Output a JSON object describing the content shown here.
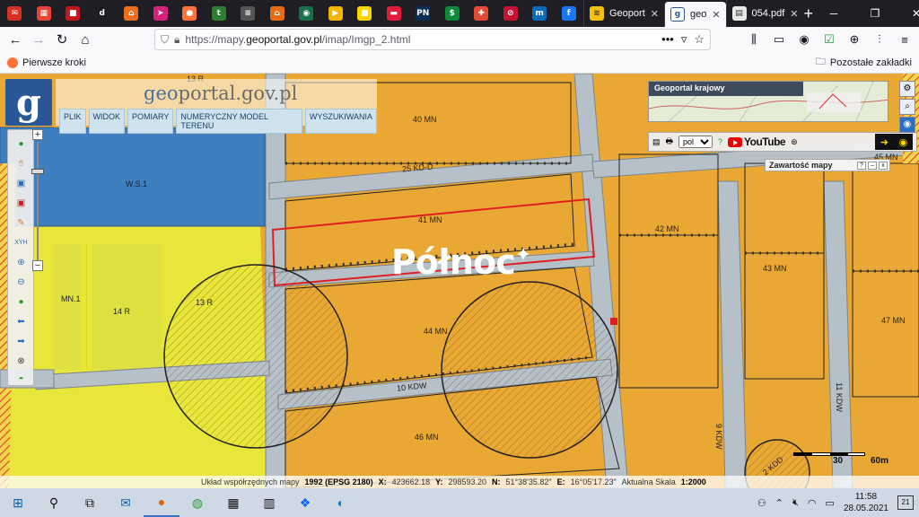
{
  "browser": {
    "pinned_tabs": [
      {
        "icon": "mail-icon",
        "bg": "#d93025",
        "glyph": "✉"
      },
      {
        "icon": "grid-icon",
        "bg": "#ea4335",
        "glyph": "▦"
      },
      {
        "icon": "news-icon",
        "bg": "#c4161c",
        "glyph": "■"
      },
      {
        "icon": "d-icon",
        "bg": "#1f1e25",
        "glyph": "d"
      },
      {
        "icon": "home-icon",
        "bg": "#f06c1e",
        "glyph": "⌂"
      },
      {
        "icon": "arrow-icon",
        "bg": "#d4227b",
        "glyph": "➤"
      },
      {
        "icon": "firefox-icon",
        "bg": "#ff7139",
        "glyph": "●"
      },
      {
        "icon": "t-icon",
        "bg": "#2e7d32",
        "glyph": "t"
      },
      {
        "icon": "stripe-icon",
        "bg": "#555555",
        "glyph": "≡"
      },
      {
        "icon": "house-icon",
        "bg": "#e66b13",
        "glyph": "⌂"
      },
      {
        "icon": "circle-icon",
        "bg": "#1b6e4b",
        "glyph": "◉"
      },
      {
        "icon": "play-icon",
        "bg": "#f5b400",
        "glyph": "▶"
      },
      {
        "icon": "yellow-icon",
        "bg": "#ffd500",
        "glyph": "■"
      },
      {
        "icon": "red-icon",
        "bg": "#e21b3c",
        "glyph": "▬"
      },
      {
        "icon": "pn-icon",
        "bg": "#0b2e59",
        "glyph": "PN"
      },
      {
        "icon": "dollar-icon",
        "bg": "#0f8a3a",
        "glyph": "$"
      },
      {
        "icon": "plus-icon",
        "bg": "#e34b35",
        "glyph": "✚"
      },
      {
        "icon": "block-icon",
        "bg": "#c41230",
        "glyph": "⊘"
      },
      {
        "icon": "m-icon",
        "bg": "#0a6cb8",
        "glyph": "m"
      },
      {
        "icon": "facebook-icon",
        "bg": "#1877f2",
        "glyph": "f"
      }
    ],
    "tabs": [
      {
        "title": "Geoport",
        "active": false,
        "icon": "layers-icon"
      },
      {
        "title": "geo",
        "active": true,
        "icon": "g-icon"
      },
      {
        "title": "054.pdf",
        "active": false,
        "icon": "pdf-icon"
      }
    ],
    "url_prefix": "https://mapy.",
    "url_domain": "geoportal.gov.pl",
    "url_path": "/imap/Imgp_2.html",
    "bookmarks": {
      "left": "Pierwsze kroki",
      "right": "Pozostałe zakładki"
    }
  },
  "geoportal": {
    "logo_letter": "g",
    "brand_prefix": "geo",
    "brand_rest": "portal.gov.pl",
    "menu": [
      "PLIK",
      "WIDOK",
      "POMIARY",
      "NUMERYCZNY MODEL TERENU",
      "WYSZUKIWANIA"
    ],
    "overview_title": "Geoportal krajowy",
    "language": "pol",
    "youtube_label": "YouTube",
    "content_panel_title": "Zawartość mapy",
    "content_panel_controls": [
      "?",
      "–",
      "x"
    ],
    "watermark": "Północ",
    "scale_labels": [
      "30",
      "60m"
    ],
    "map_labels": [
      "13 R",
      "40 MN",
      "45 MN",
      "W.S.1",
      "25 KD-D",
      "41 MN",
      "42 MN",
      "43 MN",
      "MN.1",
      "14 R",
      "13 R",
      "44 MN",
      "47 MN",
      "10 KDW",
      "46 MN",
      "9 KDW",
      "11 KDW",
      "2 KDD"
    ]
  },
  "statusbar": {
    "system_label": "Układ współrzędnych mapy",
    "system_value": "1992 (EPSG 2180)",
    "x_label": "X:",
    "x_value": "423662.18",
    "y_label": "Y:",
    "y_value": "298593.20",
    "n_label": "N:",
    "n_value": "51°38'35.82\"",
    "e_label": "E:",
    "e_value": "16°05'17.23\"",
    "scale_label": "Aktualna Skala",
    "scale_value": "1:2000"
  },
  "taskbar": {
    "time": "11:58",
    "date": "28.05.2021",
    "notifications": "21"
  }
}
